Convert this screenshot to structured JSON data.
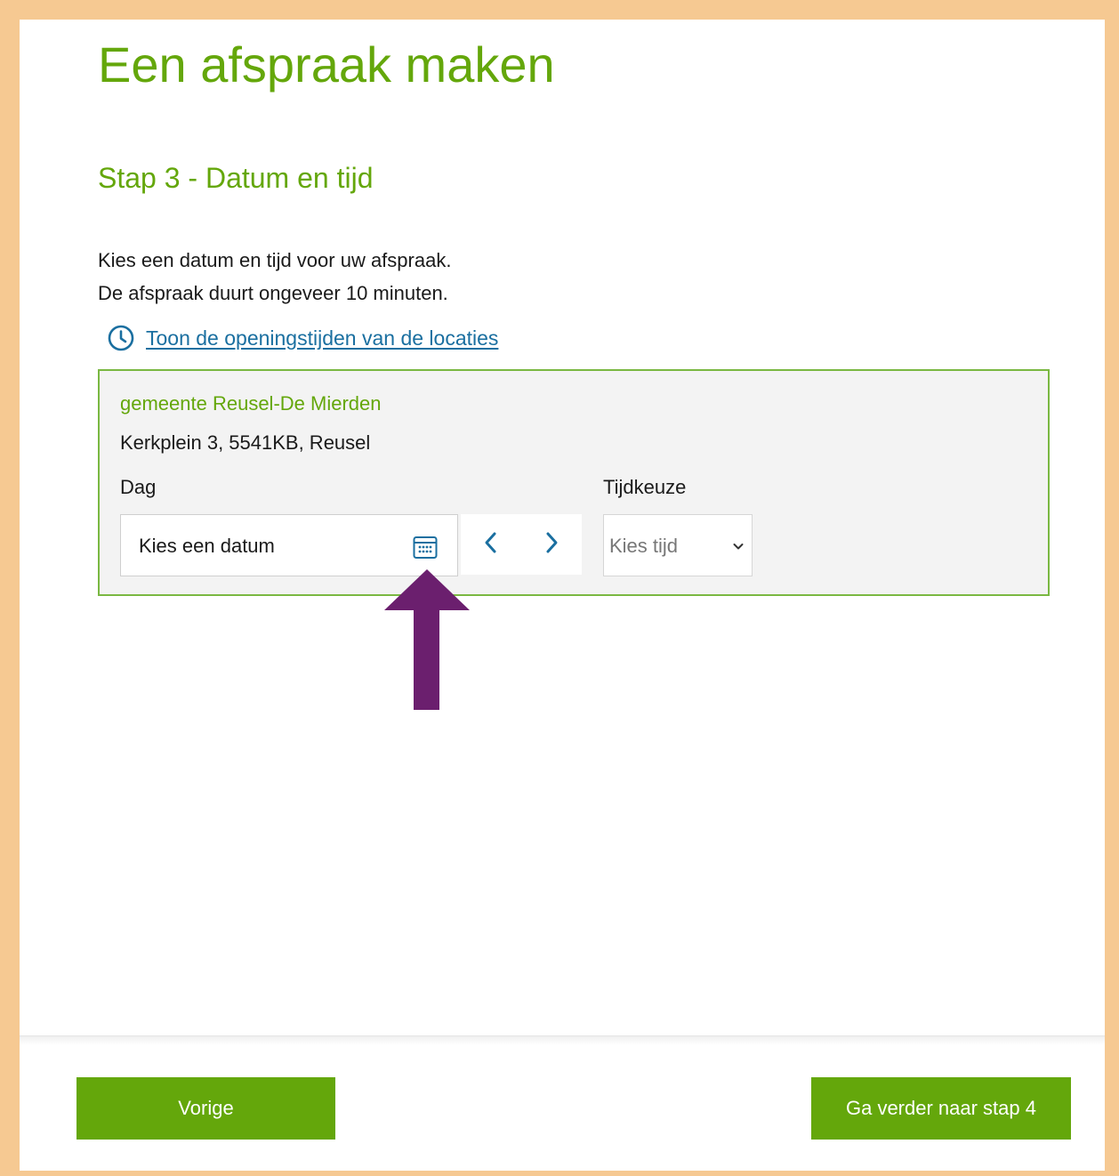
{
  "header": {
    "title": "Een afspraak maken",
    "step_title": "Stap 3 - Datum en tijd"
  },
  "intro": {
    "line1": "Kies een datum en tijd voor uw afspraak.",
    "line2": "De afspraak duurt ongeveer 10 minuten."
  },
  "opening_hours_link": {
    "label": "Toon de openingstijden van de locaties",
    "icon": "clock-icon"
  },
  "location": {
    "name": "gemeente Reusel-De Mierden",
    "address": "Kerkplein 3, 5541KB, Reusel",
    "day_label": "Dag",
    "date_placeholder": "Kies een datum",
    "date_icon": "calendar-icon",
    "prev_icon": "chevron-left-icon",
    "next_icon": "chevron-right-icon",
    "time_label": "Tijdkeuze",
    "time_value": "Kies tijd"
  },
  "annotation": {
    "arrow_icon": "arrow-up-icon",
    "arrow_color": "#6b1f6e"
  },
  "footer": {
    "prev_label": "Vorige",
    "next_label": "Ga verder naar stap 4"
  },
  "colors": {
    "brand_green": "#64a70b",
    "link_blue": "#1a6fa0",
    "frame": "#f6c992"
  }
}
